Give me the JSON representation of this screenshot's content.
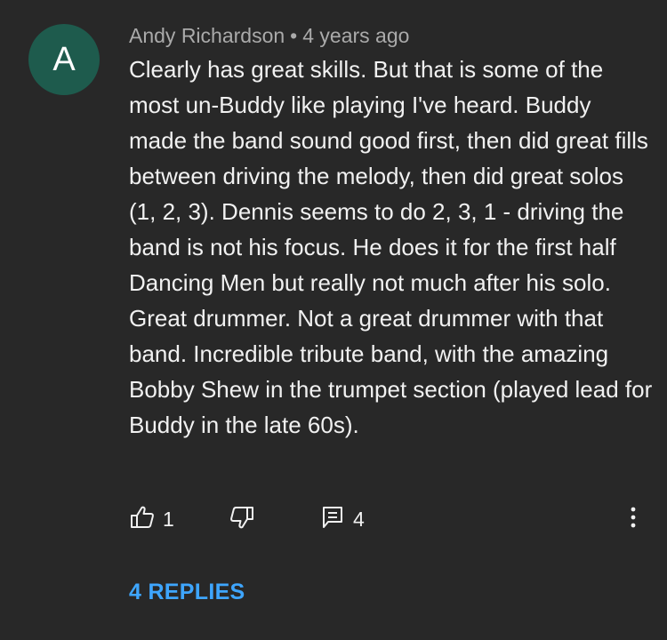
{
  "comment": {
    "avatar_letter": "A",
    "avatar_color": "#1e5b4d",
    "author": "Andy Richardson",
    "separator": "•",
    "timestamp": "4 years ago",
    "text": "Clearly has great skills. But that is some of the most un-Buddy like playing I've heard. Buddy made the band sound good first, then did great fills between driving the melody, then did great solos (1, 2, 3). Dennis seems to do 2, 3, 1 - driving the band is not his focus. He does it for the first half Dancing Men but really not much after his solo. Great drummer. Not a great drummer with that band. Incredible tribute band, with the amazing Bobby Shew in the trumpet section (played lead for Buddy in the late 60s).",
    "actions": {
      "like_icon": "thumbs-up-icon",
      "like_count": "1",
      "dislike_icon": "thumbs-down-icon",
      "reply_icon": "comment-icon",
      "reply_count": "4",
      "more_icon": "more-vertical-icon"
    },
    "replies_label": "4 REPLIES",
    "link_color": "#3ea6ff"
  }
}
